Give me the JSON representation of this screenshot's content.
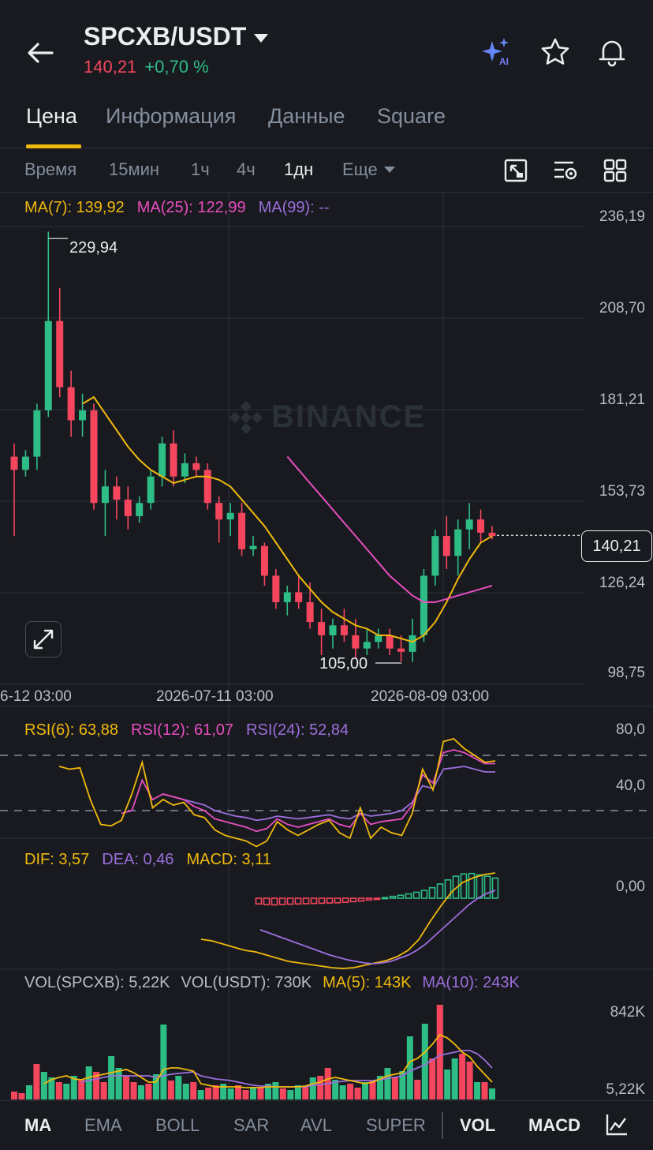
{
  "header": {
    "pair": "SPCXB/USDT",
    "price": "140,21",
    "change": "+0,70 %",
    "ai_badge": "AI"
  },
  "tabs": [
    {
      "label": "Цена",
      "active": true
    },
    {
      "label": "Информация",
      "active": false
    },
    {
      "label": "Данные",
      "active": false
    },
    {
      "label": "Square",
      "active": false
    }
  ],
  "intervals": [
    {
      "label": "Время",
      "active": false
    },
    {
      "label": "15мин",
      "active": false
    },
    {
      "label": "1ч",
      "active": false
    },
    {
      "label": "4ч",
      "active": false
    },
    {
      "label": "1дн",
      "active": true
    },
    {
      "label": "Еще",
      "active": false
    }
  ],
  "ma_legend": {
    "ma7": "MA(7): 139,92",
    "ma25": "MA(25): 122,99",
    "ma99": "MA(99): --"
  },
  "price_axis": [
    "236,19",
    "208,70",
    "181,21",
    "153,73",
    "126,24",
    "98,75"
  ],
  "current_price_tag": "140,21",
  "high_label": "229,94",
  "low_label": "105,00",
  "watermark": "BINANCE",
  "x_axis": [
    "6-12 03:00",
    "2026-07-11 03:00",
    "2026-08-09 03:00"
  ],
  "rsi": {
    "legend": {
      "rsi6": "RSI(6): 63,88",
      "rsi12": "RSI(12): 61,07",
      "rsi24": "RSI(24): 52,84"
    },
    "axis": [
      "80,0",
      "40,0"
    ]
  },
  "macd": {
    "legend": {
      "dif": "DIF: 3,57",
      "dea": "DEA: 0,46",
      "macd": "MACD: 3,11"
    },
    "axis": [
      "0,00"
    ]
  },
  "vol": {
    "legend": {
      "base": "VOL(SPCXB): 5,22K",
      "quote": "VOL(USDT): 730K",
      "ma5": "MA(5): 143K",
      "ma10": "MA(10): 243K"
    },
    "axis": [
      "842K",
      "5,22K"
    ]
  },
  "bottom_bar": [
    {
      "label": "MA",
      "active": true
    },
    {
      "label": "EMA",
      "active": false
    },
    {
      "label": "BOLL",
      "active": false
    },
    {
      "label": "SAR",
      "active": false
    },
    {
      "label": "AVL",
      "active": false
    },
    {
      "label": "SUPER",
      "active": false
    },
    {
      "label": "VOL",
      "active": true
    },
    {
      "label": "MACD",
      "active": true
    }
  ],
  "colors": {
    "up": "#2ebd85",
    "down": "#f6465d",
    "ma7": "#f0b90b",
    "ma25": "#e84ec0",
    "ma99": "#9c6fdc",
    "accent": "#f0b90b"
  },
  "chart_data": {
    "type": "candlestick",
    "y_range": [
      98.75,
      236.19
    ],
    "high": 229.94,
    "low": 105.0,
    "last": 140.21,
    "candles": [
      [
        164,
        168,
        140,
        160
      ],
      [
        160,
        166,
        158,
        164
      ],
      [
        164,
        180,
        160,
        178
      ],
      [
        178,
        232,
        176,
        205
      ],
      [
        205,
        215,
        182,
        185
      ],
      [
        185,
        190,
        170,
        175
      ],
      [
        175,
        183,
        170,
        178
      ],
      [
        178,
        180,
        148,
        150
      ],
      [
        150,
        160,
        140,
        155
      ],
      [
        155,
        158,
        145,
        151
      ],
      [
        151,
        155,
        142,
        146
      ],
      [
        146,
        152,
        144,
        150
      ],
      [
        150,
        160,
        148,
        158
      ],
      [
        158,
        170,
        155,
        168
      ],
      [
        168,
        172,
        155,
        158
      ],
      [
        158,
        165,
        156,
        162
      ],
      [
        162,
        164,
        158,
        160
      ],
      [
        160,
        162,
        148,
        150
      ],
      [
        150,
        152,
        138,
        145
      ],
      [
        145,
        150,
        140,
        147
      ],
      [
        147,
        150,
        134,
        136
      ],
      [
        136,
        140,
        134,
        137
      ],
      [
        137,
        138,
        125,
        128
      ],
      [
        128,
        130,
        118,
        120
      ],
      [
        120,
        125,
        116,
        123
      ],
      [
        123,
        128,
        118,
        120
      ],
      [
        120,
        126,
        112,
        114
      ],
      [
        114,
        118,
        104,
        110
      ],
      [
        110,
        115,
        106,
        113
      ],
      [
        113,
        118,
        108,
        110
      ],
      [
        110,
        115,
        103,
        106
      ],
      [
        106,
        112,
        104,
        108
      ],
      [
        108,
        112,
        106,
        110
      ],
      [
        110,
        112,
        104,
        106
      ],
      [
        106,
        110,
        102,
        105
      ],
      [
        105,
        115,
        102,
        110
      ],
      [
        110,
        130,
        108,
        128
      ],
      [
        128,
        142,
        125,
        140
      ],
      [
        140,
        146,
        130,
        134
      ],
      [
        134,
        145,
        128,
        142
      ],
      [
        142,
        150,
        136,
        145
      ],
      [
        145,
        148,
        138,
        141
      ],
      [
        141,
        143,
        139,
        140
      ]
    ],
    "ma7": [
      null,
      null,
      null,
      null,
      null,
      null,
      180,
      182,
      177,
      172,
      167,
      163,
      160,
      158,
      156,
      157,
      158,
      158,
      157,
      155,
      151,
      147,
      143,
      138,
      133,
      128,
      124,
      120,
      117,
      115,
      113,
      112,
      110,
      110,
      109,
      108,
      110,
      114,
      120,
      127,
      133,
      138,
      140
    ],
    "ma25": [
      null,
      null,
      null,
      null,
      null,
      null,
      null,
      null,
      null,
      null,
      null,
      null,
      null,
      null,
      null,
      null,
      null,
      null,
      null,
      null,
      null,
      null,
      null,
      null,
      164,
      160,
      156,
      152,
      148,
      144,
      140,
      136,
      132,
      128,
      125,
      122,
      120,
      120,
      121,
      122,
      123,
      124,
      125
    ]
  }
}
